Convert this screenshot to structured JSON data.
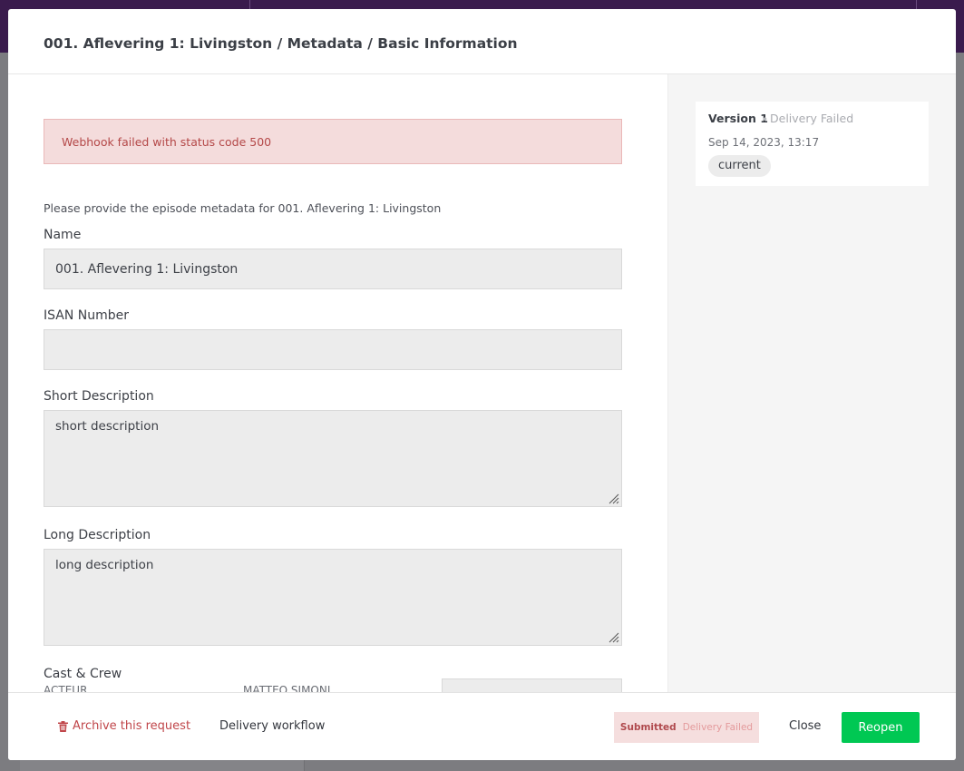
{
  "modal": {
    "title": "001. Aflevering 1: Livingston / Metadata / Basic Information"
  },
  "alert": {
    "message": "Webhook failed with status code 500"
  },
  "form": {
    "intro": "Please provide the episode metadata for 001. Aflevering 1: Livingston",
    "name": {
      "label": "Name",
      "value": "001. Aflevering 1: Livingston"
    },
    "isan": {
      "label": "ISAN Number",
      "value": ""
    },
    "short_description": {
      "label": "Short Description",
      "value": "short description"
    },
    "long_description": {
      "label": "Long Description",
      "value": "long description"
    },
    "cast_crew": {
      "label": "Cast & Crew",
      "rows": [
        {
          "role": "ACTEUR",
          "name": "MATTEO SIMONI"
        }
      ]
    }
  },
  "version": {
    "title": "Version 1",
    "separator": "•",
    "status": "Delivery Failed",
    "date": "Sep 14, 2023, 13:17",
    "badge": "current"
  },
  "footer": {
    "archive_label": "Archive this request",
    "archive_icon": "trash-icon",
    "workflow_label": "Delivery workflow",
    "status_submitted": "Submitted",
    "status_failed": "Delivery Failed",
    "close_label": "Close",
    "reopen_label": "Reopen"
  },
  "colors": {
    "accent": "#00c853",
    "danger": "#c0464a",
    "topbar": "#3a1b4d"
  }
}
